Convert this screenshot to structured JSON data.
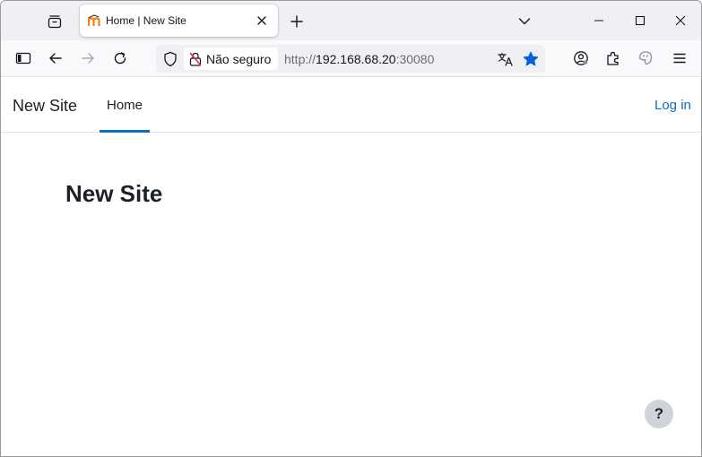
{
  "browser": {
    "tab": {
      "title": "Home | New Site"
    },
    "urlbar": {
      "security_label": "Não seguro",
      "url_scheme": "http://",
      "url_host": "192.168.68.20",
      "url_port": ":30080"
    },
    "colors": {
      "accent": "#0060df",
      "tabstrip": "#f0f0f4"
    }
  },
  "site": {
    "brand": "New Site",
    "nav": {
      "home": "Home"
    },
    "login": "Log in",
    "page_title": "New Site",
    "help_label": "?",
    "colors": {
      "primary": "#0f6cbf",
      "text": "#1d2125"
    }
  }
}
